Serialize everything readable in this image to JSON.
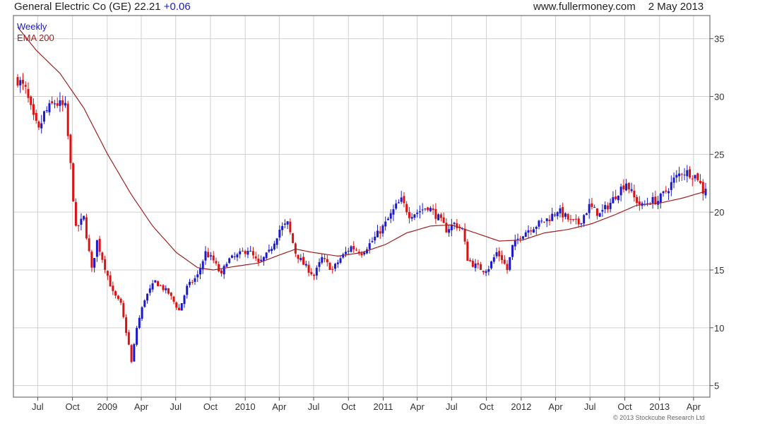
{
  "header": {
    "title": "General Electric Co (GE) 22.21",
    "change": "+0.06",
    "site": "www.fullermoney.com",
    "date": "2 May 2013"
  },
  "footer": {
    "copyright": "© 2013 Stockcube Research Ltd"
  },
  "colors": {
    "up": "#1a1acc",
    "down": "#dd1111",
    "ema": "#a02020",
    "grid": "#d0d0d0"
  },
  "chart_data": {
    "type": "candlestick",
    "legend": [
      "Weekly",
      "EMA 200"
    ],
    "ylim": [
      4,
      37
    ],
    "y_ticks": [
      5,
      10,
      15,
      20,
      25,
      30,
      35
    ],
    "x_tick_labels": [
      "Jul",
      "Oct",
      "2009",
      "Apr",
      "Jul",
      "Oct",
      "2010",
      "Apr",
      "Jul",
      "Oct",
      "2011",
      "Apr",
      "Jul",
      "Oct",
      "2012",
      "Apr",
      "Jul",
      "Oct",
      "2013",
      "Apr"
    ],
    "x_start": "2008-05-09",
    "x_end": "2013-05-03",
    "price_anchors": [
      [
        "2008-05-09",
        31.5
      ],
      [
        "2008-05-30",
        30.5
      ],
      [
        "2008-06-20",
        28.0
      ],
      [
        "2008-07-04",
        27.0
      ],
      [
        "2008-07-18",
        28.5
      ],
      [
        "2008-08-15",
        29.5
      ],
      [
        "2008-09-12",
        29.0
      ],
      [
        "2008-09-26",
        24.0
      ],
      [
        "2008-10-10",
        18.5
      ],
      [
        "2008-10-31",
        19.5
      ],
      [
        "2008-11-21",
        15.0
      ],
      [
        "2008-12-05",
        17.5
      ],
      [
        "2008-12-19",
        16.0
      ],
      [
        "2009-01-16",
        13.0
      ],
      [
        "2009-02-06",
        12.0
      ],
      [
        "2009-02-27",
        8.5
      ],
      [
        "2009-03-06",
        7.0
      ],
      [
        "2009-03-20",
        10.0
      ],
      [
        "2009-04-10",
        12.5
      ],
      [
        "2009-05-08",
        14.0
      ],
      [
        "2009-06-12",
        13.0
      ],
      [
        "2009-07-10",
        11.5
      ],
      [
        "2009-07-31",
        13.5
      ],
      [
        "2009-08-28",
        14.5
      ],
      [
        "2009-09-18",
        16.5
      ],
      [
        "2009-10-09",
        15.8
      ],
      [
        "2009-10-30",
        14.5
      ],
      [
        "2009-11-13",
        15.8
      ],
      [
        "2009-12-11",
        16.2
      ],
      [
        "2010-01-08",
        16.8
      ],
      [
        "2010-02-05",
        15.5
      ],
      [
        "2010-03-05",
        16.5
      ],
      [
        "2010-04-02",
        18.5
      ],
      [
        "2010-04-23",
        19.0
      ],
      [
        "2010-05-14",
        16.5
      ],
      [
        "2010-06-04",
        15.5
      ],
      [
        "2010-07-02",
        14.5
      ],
      [
        "2010-07-23",
        16.0
      ],
      [
        "2010-08-20",
        15.0
      ],
      [
        "2010-09-10",
        16.0
      ],
      [
        "2010-10-08",
        17.0
      ],
      [
        "2010-11-05",
        16.5
      ],
      [
        "2010-12-03",
        17.5
      ],
      [
        "2011-01-07",
        19.0
      ],
      [
        "2011-02-04",
        20.5
      ],
      [
        "2011-02-18",
        21.0
      ],
      [
        "2011-03-11",
        19.8
      ],
      [
        "2011-04-01",
        20.0
      ],
      [
        "2011-04-29",
        20.5
      ],
      [
        "2011-05-27",
        19.5
      ],
      [
        "2011-06-17",
        18.5
      ],
      [
        "2011-07-08",
        19.0
      ],
      [
        "2011-07-29",
        18.5
      ],
      [
        "2011-08-12",
        16.0
      ],
      [
        "2011-08-26",
        15.5
      ],
      [
        "2011-09-23",
        15.0
      ],
      [
        "2011-10-07",
        15.2
      ],
      [
        "2011-10-28",
        16.5
      ],
      [
        "2011-11-11",
        16.0
      ],
      [
        "2011-11-25",
        15.0
      ],
      [
        "2011-12-09",
        17.0
      ],
      [
        "2011-12-30",
        18.0
      ],
      [
        "2012-01-20",
        18.5
      ],
      [
        "2012-02-17",
        19.0
      ],
      [
        "2012-03-16",
        19.5
      ],
      [
        "2012-04-06",
        20.2
      ],
      [
        "2012-05-11",
        19.2
      ],
      [
        "2012-06-01",
        19.0
      ],
      [
        "2012-06-29",
        20.5
      ],
      [
        "2012-07-27",
        19.8
      ],
      [
        "2012-08-24",
        20.8
      ],
      [
        "2012-09-14",
        21.8
      ],
      [
        "2012-10-05",
        22.6
      ],
      [
        "2012-10-26",
        21.2
      ],
      [
        "2012-11-16",
        20.5
      ],
      [
        "2012-12-07",
        21.0
      ],
      [
        "2012-12-28",
        21.0
      ],
      [
        "2013-01-18",
        21.8
      ],
      [
        "2013-02-08",
        22.8
      ],
      [
        "2013-03-01",
        23.5
      ],
      [
        "2013-03-22",
        23.4
      ],
      [
        "2013-04-12",
        23.0
      ],
      [
        "2013-04-26",
        21.8
      ],
      [
        "2013-05-03",
        22.2
      ]
    ],
    "ema_anchors": [
      [
        "2008-05-09",
        36.0
      ],
      [
        "2008-06-27",
        34.0
      ],
      [
        "2008-08-29",
        32.0
      ],
      [
        "2008-10-31",
        29.0
      ],
      [
        "2009-01-02",
        25.0
      ],
      [
        "2009-03-06",
        21.5
      ],
      [
        "2009-05-01",
        18.8
      ],
      [
        "2009-07-03",
        16.5
      ],
      [
        "2009-08-28",
        15.2
      ],
      [
        "2009-10-09",
        15.0
      ],
      [
        "2009-12-04",
        15.3
      ],
      [
        "2010-02-05",
        15.6
      ],
      [
        "2010-04-02",
        16.3
      ],
      [
        "2010-05-14",
        16.8
      ],
      [
        "2010-07-02",
        16.5
      ],
      [
        "2010-09-03",
        16.2
      ],
      [
        "2010-11-05",
        16.5
      ],
      [
        "2011-01-07",
        17.2
      ],
      [
        "2011-03-04",
        18.2
      ],
      [
        "2011-05-06",
        18.8
      ],
      [
        "2011-07-01",
        18.9
      ],
      [
        "2011-09-02",
        18.2
      ],
      [
        "2011-11-04",
        17.5
      ],
      [
        "2012-01-06",
        17.6
      ],
      [
        "2012-03-02",
        18.2
      ],
      [
        "2012-05-04",
        18.5
      ],
      [
        "2012-07-06",
        19.0
      ],
      [
        "2012-09-07",
        19.8
      ],
      [
        "2012-11-02",
        20.6
      ],
      [
        "2013-01-04",
        20.8
      ],
      [
        "2013-03-01",
        21.2
      ],
      [
        "2013-05-03",
        21.8
      ]
    ]
  }
}
